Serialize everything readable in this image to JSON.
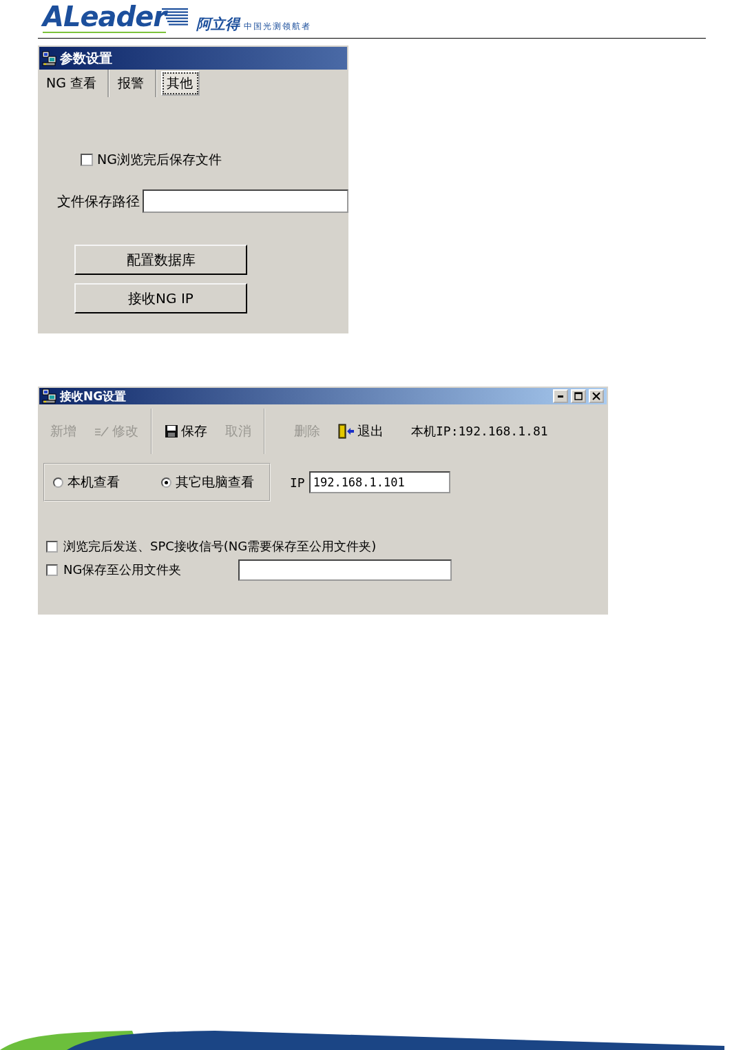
{
  "header": {
    "logo": "ALeader",
    "logo_cn": "阿立得",
    "slogan": "中国光测领航者"
  },
  "settings_dialog": {
    "title": "参数设置",
    "tabs": [
      {
        "label": "NG 查看",
        "selected": false
      },
      {
        "label": "报警",
        "selected": false
      },
      {
        "label": "其他",
        "selected": true
      }
    ],
    "checkbox": {
      "label": "NG浏览完后保存文件",
      "checked": false
    },
    "path_field": {
      "label": "文件保存路径"
    },
    "buttons": [
      "配置数据库",
      "接收NG IP"
    ]
  },
  "receive_dialog": {
    "title": "接收NG设置",
    "toolbar_groups": [
      [
        {
          "kind": "add",
          "label": "新增",
          "disabled": true
        },
        {
          "kind": "edit",
          "label": "修改",
          "disabled": true
        }
      ],
      [
        {
          "kind": "save",
          "label": "保存",
          "disabled": false
        },
        {
          "kind": "cancel",
          "label": "取消",
          "disabled": true
        }
      ],
      [
        {
          "kind": "delete",
          "label": "删除",
          "disabled": true
        },
        {
          "kind": "exit",
          "label": "退出",
          "disabled": false
        }
      ]
    ],
    "local_ip": "本机IP:192.168.1.81",
    "radios": [
      {
        "label": "本机查看",
        "selected": false
      },
      {
        "label": "其它电脑查看",
        "selected": true
      }
    ],
    "ip_field": {
      "label": "IP",
      "value": "192.168.1.101"
    },
    "checkboxes": [
      {
        "label": "浏览完后发送、SPC接收信号(NG需要保存至公用文件夹)",
        "checked": false,
        "has_field": false
      },
      {
        "label": "NG保存至公用文件夹",
        "checked": false,
        "has_field": true
      }
    ]
  }
}
